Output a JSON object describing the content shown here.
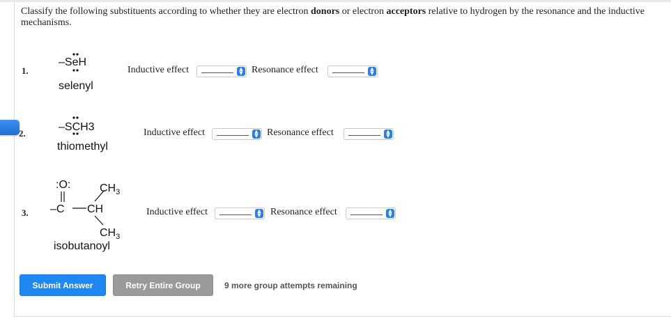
{
  "instructions": {
    "part1": "Classify the following substituents according to whether they are electron ",
    "donors": "donors",
    "part2": " or electron ",
    "acceptors": "acceptors",
    "part3": " relative to hydrogen by the resonance and the inductive mechanisms."
  },
  "questions": [
    {
      "number": "1.",
      "formula": "–SeH",
      "name": "selenyl",
      "inductive_label": "Inductive effect",
      "inductive_value": "______",
      "resonance_label": "Resonance effect",
      "resonance_value": "______"
    },
    {
      "number": "2.",
      "formula": "–SCH3",
      "name": "thiomethyl",
      "inductive_label": "Inductive effect",
      "inductive_value": "______",
      "resonance_label": "Resonance effect",
      "resonance_value": "______"
    },
    {
      "number": "3.",
      "name": "isobutanoyl",
      "inductive_label": "Inductive effect",
      "inductive_value": "______",
      "resonance_label": "Resonance effect",
      "resonance_value": "______"
    }
  ],
  "structure3": {
    "o": ":O:",
    "c": "–C",
    "ch": "CH",
    "ch3_top": "CH",
    "ch3_bottom": "CH",
    "sub3": "3"
  },
  "buttons": {
    "submit": "Submit Answer",
    "retry": "Retry Entire Group"
  },
  "attempts_text": "9 more group attempts remaining",
  "colors": {
    "accent": "#1e88f0",
    "retry": "#9a9a9a",
    "select_arrow": "#2f7de1"
  }
}
